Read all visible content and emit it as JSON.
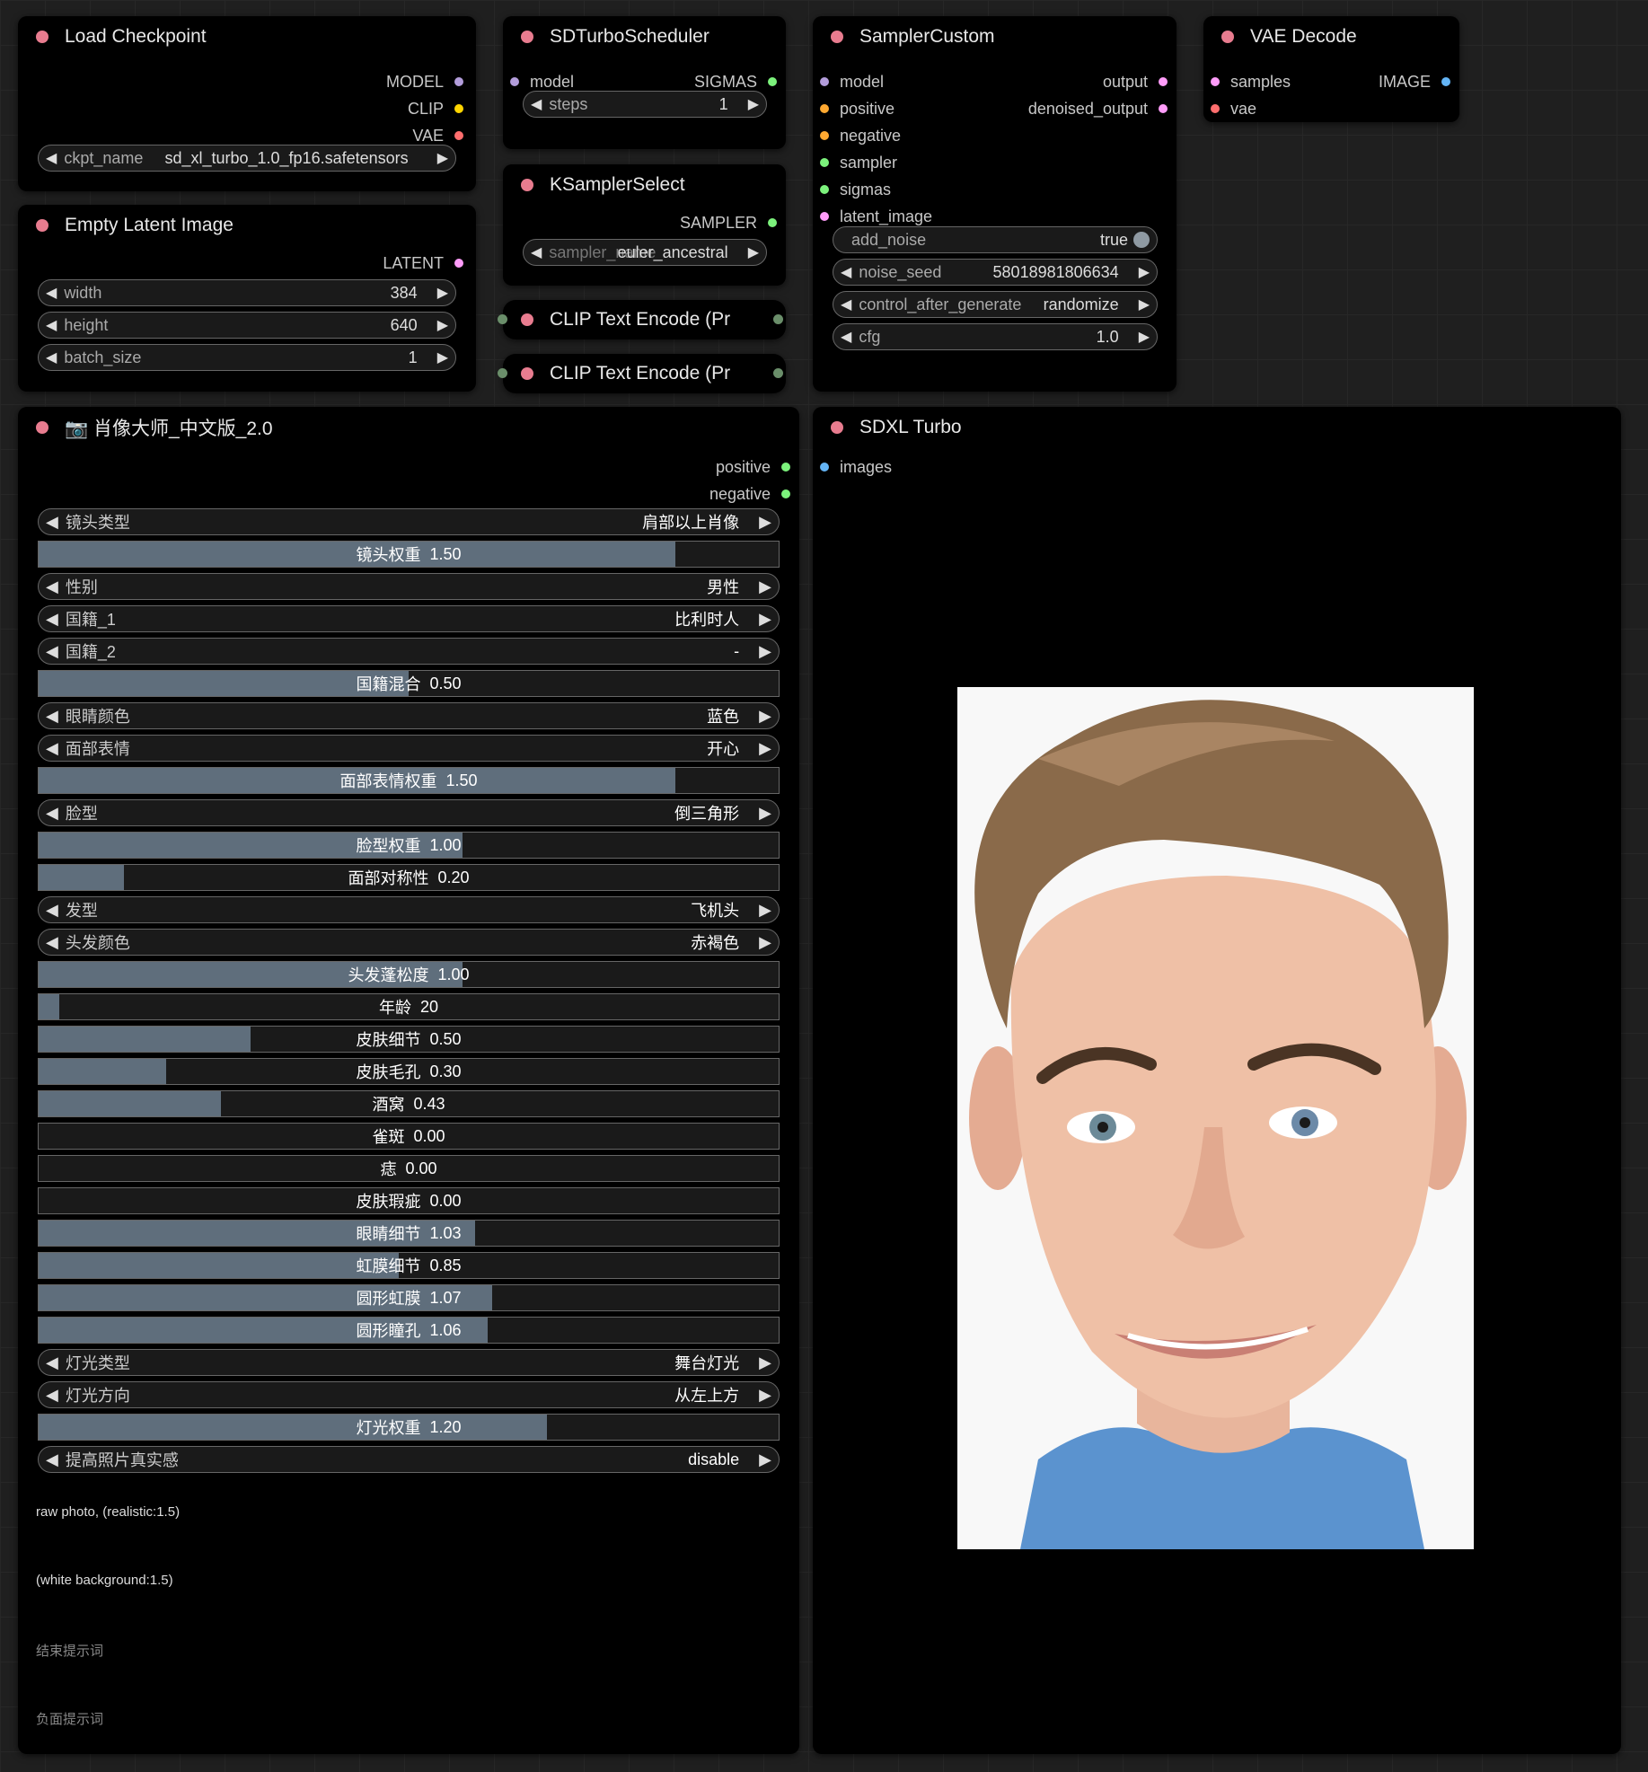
{
  "colors": {
    "canvas": "#1f1f1f",
    "node_bg": "#000000",
    "title_dot": "#e87c8f",
    "slider_fill": "#5f6e7c"
  },
  "load_checkpoint": {
    "title": "Load Checkpoint",
    "outputs": [
      {
        "label": "MODEL",
        "color": "#b39ddb"
      },
      {
        "label": "CLIP",
        "color": "#ffd500"
      },
      {
        "label": "VAE",
        "color": "#ff6e6e"
      }
    ],
    "ckpt_label": "ckpt_name",
    "ckpt_value": "sd_xl_turbo_1.0_fp16.safetensors"
  },
  "empty_latent": {
    "title": "Empty Latent Image",
    "output": "LATENT",
    "output_color": "#ff9cf9",
    "width_label": "width",
    "width": "384",
    "height_label": "height",
    "height": "640",
    "batch_label": "batch_size",
    "batch": "1"
  },
  "sd_turbo_scheduler": {
    "title": "SDTurboScheduler",
    "input": "model",
    "output": "SIGMAS",
    "steps_label": "steps",
    "steps": "1"
  },
  "ksampler_select": {
    "title": "KSamplerSelect",
    "output": "SAMPLER",
    "sampler_label": "sampler_name",
    "sampler_value": "euler_ancestral"
  },
  "clip_text_1": {
    "title": "CLIP Text Encode (Pr"
  },
  "clip_text_2": {
    "title": "CLIP Text Encode (Pr"
  },
  "sampler_custom": {
    "title": "SamplerCustom",
    "inputs": [
      {
        "label": "model",
        "color": "#b39ddb"
      },
      {
        "label": "positive",
        "color": "#ffa931"
      },
      {
        "label": "negative",
        "color": "#ffa931"
      },
      {
        "label": "sampler",
        "color": "#7cf27c"
      },
      {
        "label": "sigmas",
        "color": "#7cf27c"
      },
      {
        "label": "latent_image",
        "color": "#ff9cf9"
      }
    ],
    "outputs": [
      {
        "label": "output",
        "color": "#ff9cf9"
      },
      {
        "label": "denoised_output",
        "color": "#ff9cf9"
      }
    ],
    "add_noise_label": "add_noise",
    "add_noise": "true",
    "noise_seed_label": "noise_seed",
    "noise_seed": "58018981806634",
    "control_label": "control_after_generate",
    "control": "randomize",
    "cfg_label": "cfg",
    "cfg": "1.0"
  },
  "vae_decode": {
    "title": "VAE Decode",
    "inputs": [
      {
        "label": "samples",
        "color": "#ff9cf9"
      },
      {
        "label": "vae",
        "color": "#ff6e6e"
      }
    ],
    "output": "IMAGE",
    "output_color": "#64b5f6"
  },
  "portrait_master": {
    "title": "📷 肖像大师_中文版_2.0",
    "outputs": [
      "positive",
      "negative"
    ],
    "widgets": [
      {
        "kind": "combo",
        "label": "镜头类型",
        "value": "肩部以上肖像"
      },
      {
        "kind": "slider",
        "label": "镜头权重",
        "value": "1.50",
        "fraction": 0.86
      },
      {
        "kind": "combo",
        "label": "性别",
        "value": "男性"
      },
      {
        "kind": "combo",
        "label": "国籍_1",
        "value": "比利时人"
      },
      {
        "kind": "combo",
        "label": "国籍_2",
        "value": "-"
      },
      {
        "kind": "slider",
        "label": "国籍混合",
        "value": "0.50",
        "fraction": 0.5
      },
      {
        "kind": "combo",
        "label": "眼睛颜色",
        "value": "蓝色"
      },
      {
        "kind": "combo",
        "label": "面部表情",
        "value": "开心"
      },
      {
        "kind": "slider",
        "label": "面部表情权重",
        "value": "1.50",
        "fraction": 0.86
      },
      {
        "kind": "combo",
        "label": "脸型",
        "value": "倒三角形"
      },
      {
        "kind": "slider",
        "label": "脸型权重",
        "value": "1.00",
        "fraction": 0.573
      },
      {
        "kind": "slider",
        "label": "面部对称性",
        "value": "0.20",
        "fraction": 0.115
      },
      {
        "kind": "combo",
        "label": "发型",
        "value": "飞机头"
      },
      {
        "kind": "combo",
        "label": "头发颜色",
        "value": "赤褐色"
      },
      {
        "kind": "slider",
        "label": "头发蓬松度",
        "value": "1.00",
        "fraction": 0.573
      },
      {
        "kind": "slider",
        "label": "年龄",
        "value": "20",
        "fraction": 0.028
      },
      {
        "kind": "slider",
        "label": "皮肤细节",
        "value": "0.50",
        "fraction": 0.287
      },
      {
        "kind": "slider",
        "label": "皮肤毛孔",
        "value": "0.30",
        "fraction": 0.172
      },
      {
        "kind": "slider",
        "label": "酒窝",
        "value": "0.43",
        "fraction": 0.246
      },
      {
        "kind": "slider",
        "label": "雀斑",
        "value": "0.00",
        "fraction": 0
      },
      {
        "kind": "slider",
        "label": "痣",
        "value": "0.00",
        "fraction": 0
      },
      {
        "kind": "slider",
        "label": "皮肤瑕疵",
        "value": "0.00",
        "fraction": 0
      },
      {
        "kind": "slider",
        "label": "眼睛细节",
        "value": "1.03",
        "fraction": 0.59
      },
      {
        "kind": "slider",
        "label": "虹膜细节",
        "value": "0.85",
        "fraction": 0.487
      },
      {
        "kind": "slider",
        "label": "圆形虹膜",
        "value": "1.07",
        "fraction": 0.613
      },
      {
        "kind": "slider",
        "label": "圆形瞳孔",
        "value": "1.06",
        "fraction": 0.607
      },
      {
        "kind": "combo",
        "label": "灯光类型",
        "value": "舞台灯光"
      },
      {
        "kind": "combo",
        "label": "灯光方向",
        "value": "从左上方"
      },
      {
        "kind": "slider",
        "label": "灯光权重",
        "value": "1.20",
        "fraction": 0.687
      },
      {
        "kind": "combo",
        "label": "提高照片真实感",
        "value": "disable"
      }
    ],
    "prompts": [
      "raw photo, (realistic:1.5)",
      "(white background:1.5)",
      "结束提示词",
      "负面提示词"
    ]
  },
  "sdxl_turbo": {
    "title": "SDXL Turbo",
    "input": "images",
    "image_desc": "portrait-photo"
  }
}
